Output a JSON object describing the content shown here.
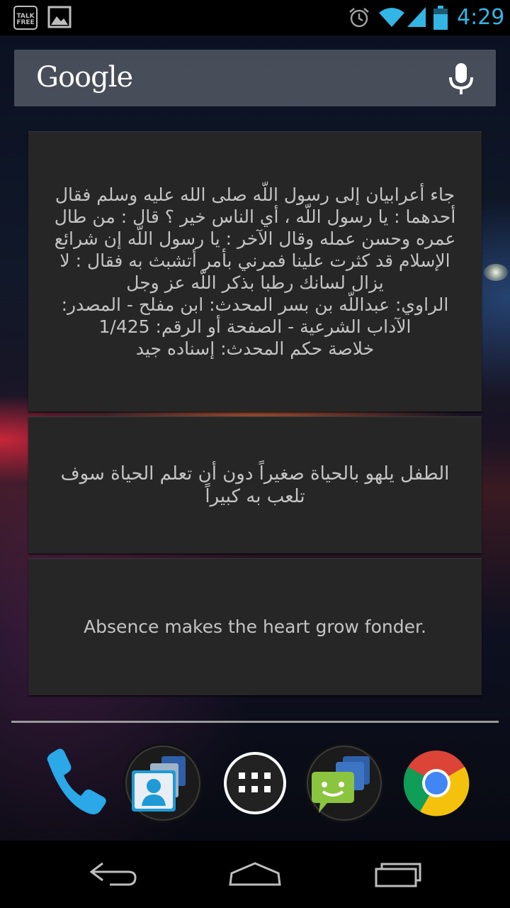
{
  "status_bar": {
    "time": "4:29",
    "left_icons": [
      "talkfree-icon",
      "gallery-icon"
    ],
    "right_icons": [
      "alarm-icon",
      "wifi-icon",
      "signal-icon",
      "battery-icon"
    ],
    "talkfree_label": "TALK FREE",
    "accent_color": "#33b5e5"
  },
  "search": {
    "logo": "Google",
    "icon": "mic-icon"
  },
  "widgets": [
    {
      "lines": [
        "جاء أعرابيان إلى رسول اللّه صلى الله عليه وسلم فقال",
        "أحدهما : يا رسول اللّه ، أي الناس خير ؟ قال : من طال",
        "عمره وحسن عمله وقال الآخر : يا رسول اللّه إن شرائع",
        "الإسلام قد كثرت علينا فمرني بأمر أتشبث به فقال : لا",
        "يزال لسانك رطبا بذكر اللّه عز وجل",
        "الراوي: عبداللّه بن بسر المحدث: ابن مفلح - المصدر:",
        "الآداب الشرعية - الصفحة أو الرقم: 1/425",
        "خلاصة حكم المحدث: إسناده جيد"
      ]
    },
    {
      "lines": [
        "الطفل يلهو بالحياة صغيراً دون أن تعلم الحياة سوف",
        "تلعب به كبيراً"
      ]
    },
    {
      "lines": [
        "Absence makes the heart grow fonder."
      ]
    }
  ],
  "dock": [
    "phone-icon",
    "contacts-folder-icon",
    "all-apps-icon",
    "messaging-folder-icon",
    "chrome-icon"
  ],
  "nav_bar": [
    "back-icon",
    "home-icon",
    "recents-icon"
  ]
}
